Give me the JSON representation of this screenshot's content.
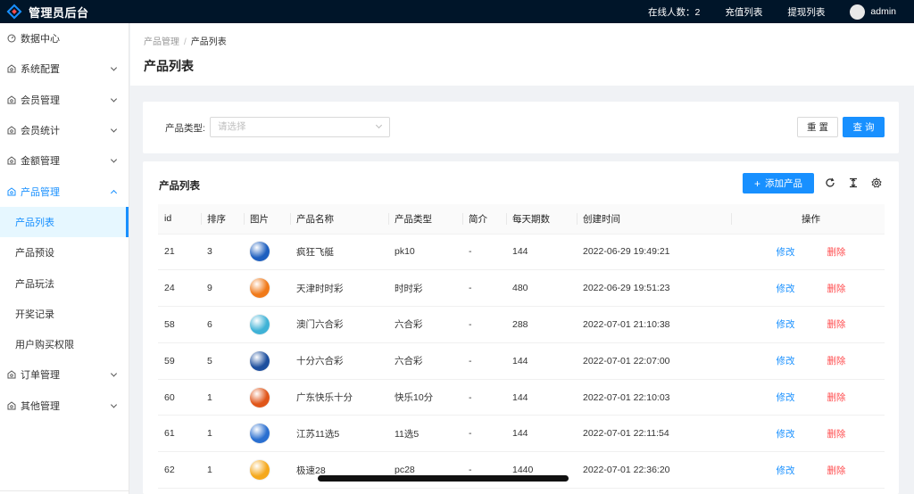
{
  "header": {
    "title": "管理员后台",
    "online_label": "在线人数：2",
    "links": [
      "充值列表",
      "提现列表"
    ],
    "username": "admin"
  },
  "sidebar": {
    "items": [
      {
        "label": "数据中心",
        "icon": "dashboard-icon"
      },
      {
        "label": "系统配置",
        "icon": "settings-icon"
      },
      {
        "label": "会员管理",
        "icon": "member-icon"
      },
      {
        "label": "会员统计",
        "icon": "stats-icon"
      },
      {
        "label": "金额管理",
        "icon": "money-icon"
      },
      {
        "label": "产品管理",
        "icon": "product-icon",
        "open": true
      }
    ],
    "sub_items": [
      "产品列表",
      "产品预设",
      "产品玩法",
      "开奖记录",
      "用户购买权限"
    ],
    "bottom_items": [
      {
        "label": "订单管理",
        "icon": "order-icon"
      },
      {
        "label": "其他管理",
        "icon": "other-icon"
      }
    ]
  },
  "breadcrumb": {
    "parent": "产品管理",
    "separator": "/",
    "current": "产品列表"
  },
  "page_title": "产品列表",
  "filter": {
    "label": "产品类型:",
    "placeholder": "请选择",
    "reset_label": "重 置",
    "query_label": "查 询"
  },
  "table": {
    "title": "产品列表",
    "add_label": "添加产品",
    "columns": [
      "id",
      "排序",
      "图片",
      "产品名称",
      "产品类型",
      "简介",
      "每天期数",
      "创建时间",
      "操作"
    ],
    "edit_label": "修改",
    "delete_label": "删除",
    "rows": [
      {
        "id": "21",
        "sort": "3",
        "name": "疯狂飞艇",
        "type": "pk10",
        "intro": "-",
        "periods": "144",
        "created": "2022-06-29 19:49:21",
        "img_color": "#1e5fbf"
      },
      {
        "id": "24",
        "sort": "9",
        "name": "天津时时彩",
        "type": "时时彩",
        "intro": "-",
        "periods": "480",
        "created": "2022-06-29 19:51:23",
        "img_color": "#f07a1a"
      },
      {
        "id": "58",
        "sort": "6",
        "name": "澳门六合彩",
        "type": "六合彩",
        "intro": "-",
        "periods": "288",
        "created": "2022-07-01 21:10:38",
        "img_color": "#3fb2d6"
      },
      {
        "id": "59",
        "sort": "5",
        "name": "十分六合彩",
        "type": "六合彩",
        "intro": "-",
        "periods": "144",
        "created": "2022-07-01 22:07:00",
        "img_color": "#1d4f9e"
      },
      {
        "id": "60",
        "sort": "1",
        "name": "广东快乐十分",
        "type": "快乐10分",
        "intro": "-",
        "periods": "144",
        "created": "2022-07-01 22:10:03",
        "img_color": "#e0561a"
      },
      {
        "id": "61",
        "sort": "1",
        "name": "江苏11选5",
        "type": "11选5",
        "intro": "-",
        "periods": "144",
        "created": "2022-07-01 22:11:54",
        "img_color": "#2a6fd0"
      },
      {
        "id": "62",
        "sort": "1",
        "name": "极速28",
        "type": "pc28",
        "intro": "-",
        "periods": "1440",
        "created": "2022-07-01 22:36:20",
        "img_color": "#f5a81c"
      }
    ]
  }
}
